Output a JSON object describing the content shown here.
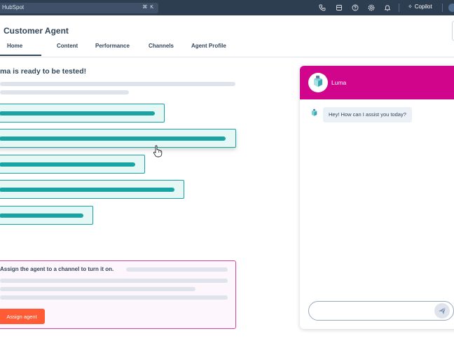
{
  "topbar": {
    "search_label": "HubSpot",
    "shortcut": "⌘ K",
    "copilot_label": "Copilot"
  },
  "page": {
    "title": "Customer Agent"
  },
  "tabs": [
    {
      "label": "Home",
      "active": true
    },
    {
      "label": "Content",
      "active": false
    },
    {
      "label": "Performance",
      "active": false
    },
    {
      "label": "Channels",
      "active": false
    },
    {
      "label": "Agent Profile",
      "active": false
    }
  ],
  "main": {
    "ready_text": "ma is ready to be tested!",
    "assign_text": "Assign the agent to a channel to turn it on.",
    "assign_button": "Assign agent"
  },
  "chat": {
    "agent_name": "Luma",
    "greeting": "Hey! How can I assist you today?"
  },
  "colors": {
    "topbar": "#2d3e50",
    "teal": "#1aa3a3",
    "magenta": "#d1058c",
    "orange": "#ff5c35"
  }
}
